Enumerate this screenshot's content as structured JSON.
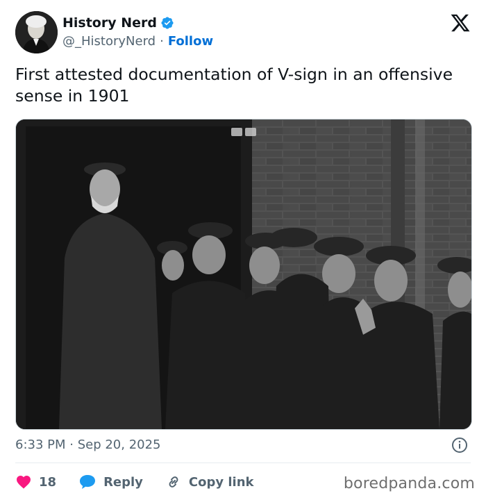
{
  "author": {
    "display_name": "History Nerd",
    "handle": "@_HistoryNerd",
    "separator": "·",
    "follow_label": "Follow"
  },
  "tweet": {
    "text": "First attested documentation of V-sign in an offensive sense in 1901",
    "timestamp": "6:33 PM · Sep 20, 2025"
  },
  "actions": {
    "like_count": "18",
    "reply_label": "Reply",
    "copy_link_label": "Copy link"
  },
  "watermark": "boredpanda.com",
  "colors": {
    "link_blue": "#006fd6",
    "verified_blue": "#1d9bf0",
    "like_pink": "#f91880",
    "reply_blue": "#1d9bf0",
    "text_gray": "#536471"
  },
  "icons": [
    "verified-badge-icon",
    "x-logo-icon",
    "info-icon",
    "heart-icon",
    "reply-bubble-icon",
    "link-icon"
  ]
}
